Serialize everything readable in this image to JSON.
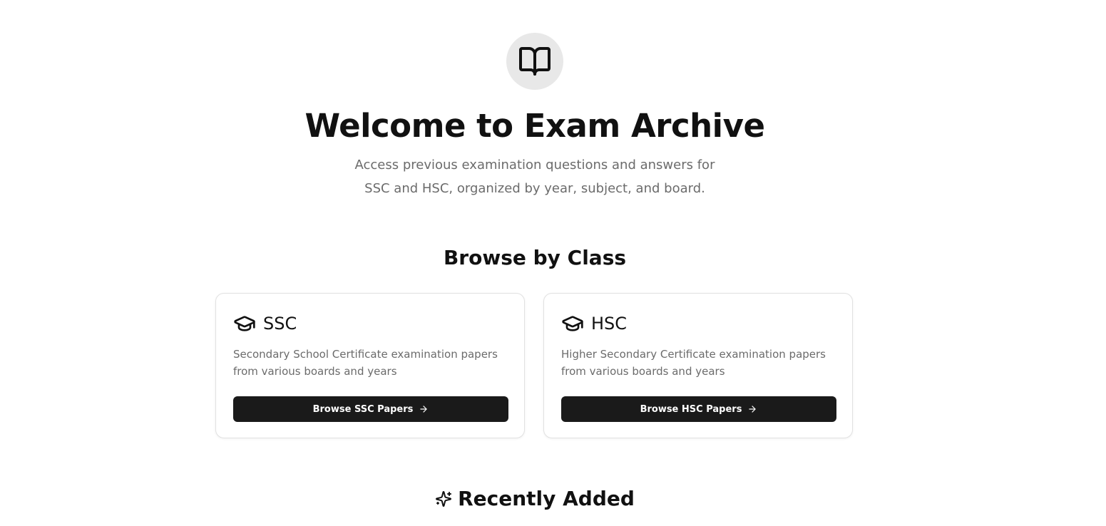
{
  "hero": {
    "icon": "book-open-icon",
    "title": "Welcome to Exam Archive",
    "subtitle_line1": "Access previous examination questions and answers for",
    "subtitle_line2": "SSC and HSC, organized by year, subject, and board."
  },
  "browse": {
    "title": "Browse by Class",
    "cards": [
      {
        "icon": "graduation-cap-icon",
        "label": "SSC",
        "description": "Secondary School Certificate examination papers from various boards and years",
        "button_label": "Browse SSC Papers",
        "button_icon": "arrow-right-icon"
      },
      {
        "icon": "graduation-cap-icon",
        "label": "HSC",
        "description": "Higher Secondary Certificate examination papers from various boards and years",
        "button_label": "Browse HSC Papers",
        "button_icon": "arrow-right-icon"
      }
    ]
  },
  "recent": {
    "icon": "sparkles-icon",
    "title": "Recently Added"
  },
  "colors": {
    "primary_button": "#1a1a1a",
    "muted_text": "#6b6b6b",
    "icon_circle": "#e8e8e8"
  }
}
